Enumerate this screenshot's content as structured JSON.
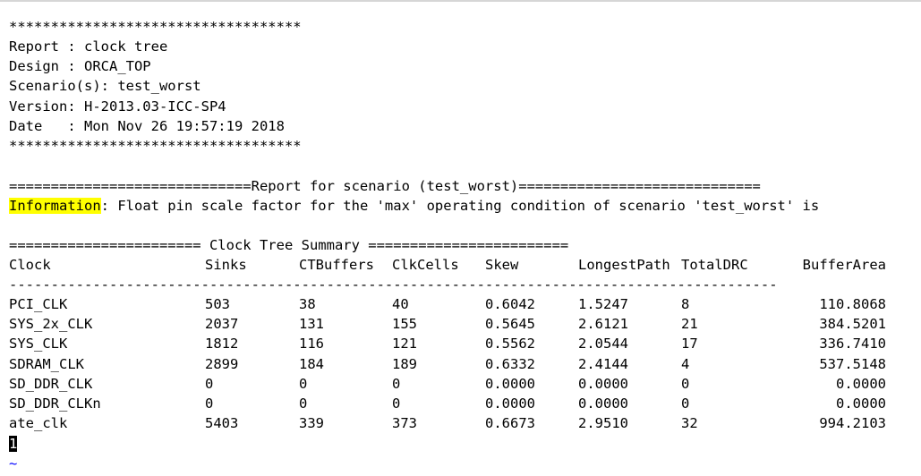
{
  "terminal": {
    "stars": "***********************************",
    "header_lines": [
      "Report : clock tree",
      "Design : ORCA_TOP",
      "Scenario(s): test_worst",
      "Version: H-2013.03-ICC-SP4",
      "Date   : Mon Nov 26 19:57:19 2018"
    ],
    "scenario_banner": "=============================Report for scenario (test_worst)=============================",
    "info_label": "Information",
    "info_text": ": Float pin scale factor for the 'max' operating condition of scenario 'test_worst' is",
    "summary_banner": "======================= Clock Tree Summary ========================",
    "divider": "--------------------------------------------------------------------------------------------",
    "cursor_char": "1",
    "tilde": "~"
  },
  "table": {
    "columns": [
      "Clock",
      "Sinks",
      "CTBuffers",
      "ClkCells",
      "Skew",
      "LongestPath",
      "TotalDRC",
      "BufferArea"
    ],
    "rows": [
      [
        "PCI_CLK",
        "503",
        "38",
        "40",
        "0.6042",
        "1.5247",
        "8",
        "110.8068"
      ],
      [
        "SYS_2x_CLK",
        "2037",
        "131",
        "155",
        "0.5645",
        "2.6121",
        "21",
        "384.5201"
      ],
      [
        "SYS_CLK",
        "1812",
        "116",
        "121",
        "0.5562",
        "2.0544",
        "17",
        "336.7410"
      ],
      [
        "SDRAM_CLK",
        "2899",
        "184",
        "189",
        "0.6332",
        "2.4144",
        "4",
        "537.5148"
      ],
      [
        "SD_DDR_CLK",
        "0",
        "0",
        "0",
        "0.0000",
        "0.0000",
        "0",
        "0.0000"
      ],
      [
        "SD_DDR_CLKn",
        "0",
        "0",
        "0",
        "0.0000",
        "0.0000",
        "0",
        "0.0000"
      ],
      [
        "ate_clk",
        "5403",
        "339",
        "373",
        "0.6673",
        "2.9510",
        "32",
        "994.2103"
      ]
    ]
  }
}
